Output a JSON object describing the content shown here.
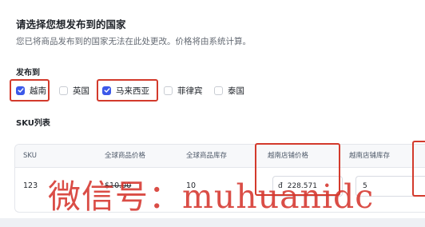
{
  "header": {
    "title": "请选择您想发布到的国家",
    "subtitle": "您已将商品发布到的国家无法在此处更改。价格将由系统计算。"
  },
  "publish": {
    "label": "发布到",
    "options": [
      {
        "label": "越南",
        "checked": true
      },
      {
        "label": "英国",
        "checked": false
      },
      {
        "label": "马来西亚",
        "checked": true
      },
      {
        "label": "菲律宾",
        "checked": false
      },
      {
        "label": "泰国",
        "checked": false
      }
    ]
  },
  "sku": {
    "label": "SKU列表",
    "columns": [
      "SKU",
      "全球商品价格",
      "全球商品库存",
      "越南店铺价格",
      "越南店铺库存"
    ],
    "row": {
      "sku": "123",
      "global_price": "$10.00",
      "global_stock": "10",
      "vn_price_currency": "đ",
      "vn_price": "228.571",
      "vn_stock": "5"
    }
  },
  "watermark": "微信号：muhuanidc",
  "colors": {
    "accent": "#3c59e9",
    "highlight": "#d33a2c",
    "watermark": "#d63a32"
  }
}
